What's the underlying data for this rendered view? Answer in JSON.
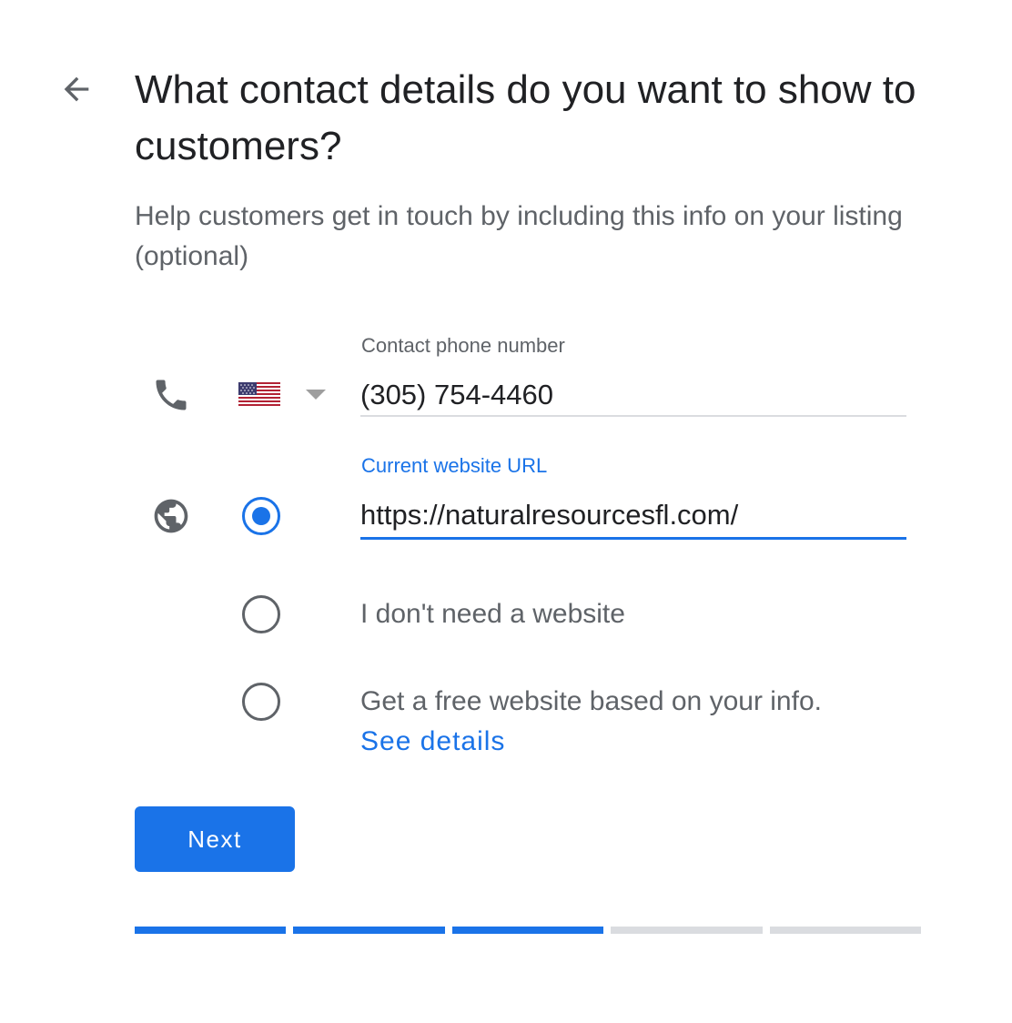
{
  "header": {
    "back_icon": "arrow-back-icon",
    "title": "What contact details do you want to show to customers?",
    "subtitle": "Help customers get in touch by including this info on your listing (optional)"
  },
  "phone": {
    "icon": "phone-icon",
    "label": "Contact phone number",
    "country_flag": "us-flag-icon",
    "value": "(305) 754-4460"
  },
  "website": {
    "icon": "globe-icon",
    "label": "Current website URL",
    "value": "https://naturalresourcesfl.com/",
    "options": [
      {
        "label": "",
        "selected": true
      },
      {
        "label": "I don't need a website",
        "selected": false
      },
      {
        "label": "Get a free website based on your info.",
        "selected": false
      }
    ],
    "see_details": "See details"
  },
  "actions": {
    "next_label": "Next"
  },
  "progress": {
    "total_steps": 5,
    "completed_steps": 3
  },
  "colors": {
    "accent": "#1a73e8",
    "text_primary": "#202124",
    "text_secondary": "#5f6368",
    "divider": "#dadce0"
  }
}
